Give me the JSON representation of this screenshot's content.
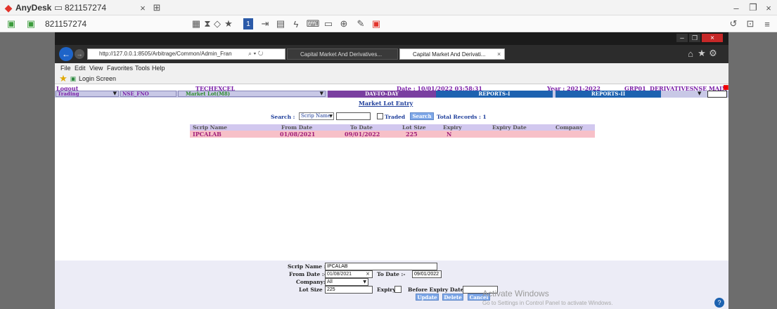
{
  "anydesk": {
    "app_name": "AnyDesk",
    "tab_id": "821157274",
    "address_id": "821157274"
  },
  "ie": {
    "url": "http://127.0.0.1:8505/Arbitrage/Common/Admin_Fran",
    "tabs": [
      "Capital Market And Derivatives...",
      "Capital Market And Derivati..."
    ],
    "menu": [
      "File",
      "Edit",
      "View",
      "Favorites",
      "Tools",
      "Help"
    ],
    "favorite": "Login Screen"
  },
  "header": {
    "logout": "Logout",
    "company": "TECHEXCEL",
    "date": "Date : 10/01/2022 03:58:31",
    "year": "Year : 2021-2022",
    "grp": "GRP01",
    "segment": "DERIVATIVES",
    "exchange": "NSE MAIN"
  },
  "menubar": {
    "module": "Trading",
    "exchange": "NSE_FNO",
    "page": "Market Lot(M8)",
    "day": "DAY-TO-DAY",
    "reports1": "REPORTS-I",
    "reports2": "REPORTS-II"
  },
  "content": {
    "title": "Market Lot Entry",
    "search_label": "Search :",
    "search_by": "Scrip Name",
    "search_value": "",
    "traded_label": "Traded",
    "search_button": "Search",
    "total_records": "Total Records : 1"
  },
  "table": {
    "headers": [
      "Scrip Name",
      "From Date",
      "To Date",
      "Lot Size",
      "Expiry",
      "Expiry Date",
      "Company"
    ],
    "rows": [
      [
        "IPCALAB",
        "01/08/2021",
        "09/01/2022",
        "225",
        "N",
        "",
        ""
      ]
    ]
  },
  "form": {
    "scrip_label": "Scrip Name :-",
    "scrip_value": "IPCALAB",
    "from_label": "From Date :-",
    "from_value": "01/08/2021",
    "to_label": "To Date :-",
    "to_value": "09/01/2022",
    "company_label": "Company:-",
    "company_value": "All",
    "lot_label": "Lot Size :-",
    "lot_value": "225",
    "expiry_label": "Expiry",
    "before_expiry_label": "Before Expiry Date",
    "update": "Update",
    "delete": "Delete",
    "cancel": "Cancel"
  },
  "watermark": {
    "line1": "Activate Windows",
    "line2": "Go to Settings in Control Panel to activate Windows."
  }
}
